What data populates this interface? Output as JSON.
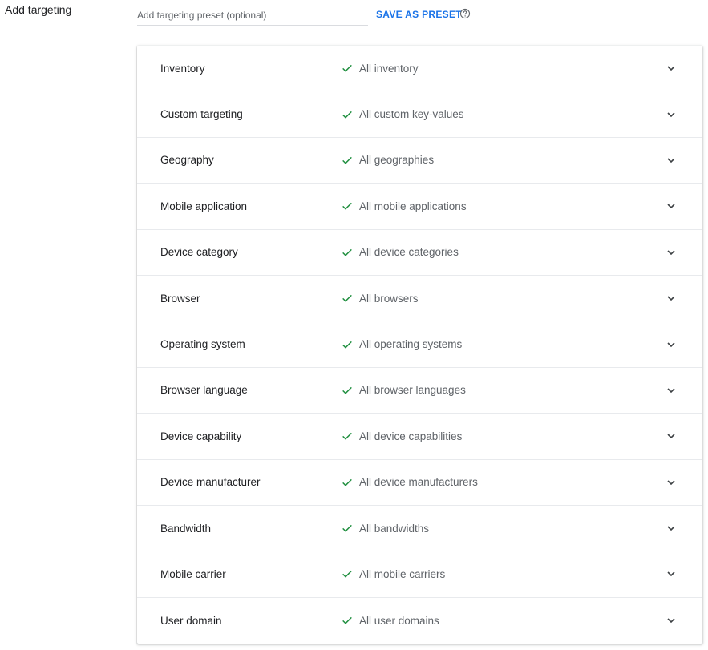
{
  "section": {
    "label": "Add targeting"
  },
  "preset": {
    "placeholder": "Add targeting preset (optional)",
    "value": "",
    "save_label": "SAVE AS PRESET",
    "help_icon": "help-circle-icon"
  },
  "colors": {
    "accent": "#1a73e8",
    "check": "#1e8e3e",
    "muted_text": "#5f6368",
    "primary_text": "#202124"
  },
  "rows": [
    {
      "title": "Inventory",
      "value": "All inventory"
    },
    {
      "title": "Custom targeting",
      "value": "All custom key-values"
    },
    {
      "title": "Geography",
      "value": "All geographies"
    },
    {
      "title": "Mobile application",
      "value": "All mobile applications"
    },
    {
      "title": "Device category",
      "value": "All device categories"
    },
    {
      "title": "Browser",
      "value": "All browsers"
    },
    {
      "title": "Operating system",
      "value": "All operating systems"
    },
    {
      "title": "Browser language",
      "value": "All browser languages"
    },
    {
      "title": "Device capability",
      "value": "All device capabilities"
    },
    {
      "title": "Device manufacturer",
      "value": "All device manufacturers"
    },
    {
      "title": "Bandwidth",
      "value": "All bandwidths"
    },
    {
      "title": "Mobile carrier",
      "value": "All mobile carriers"
    },
    {
      "title": "User domain",
      "value": "All user domains"
    }
  ]
}
